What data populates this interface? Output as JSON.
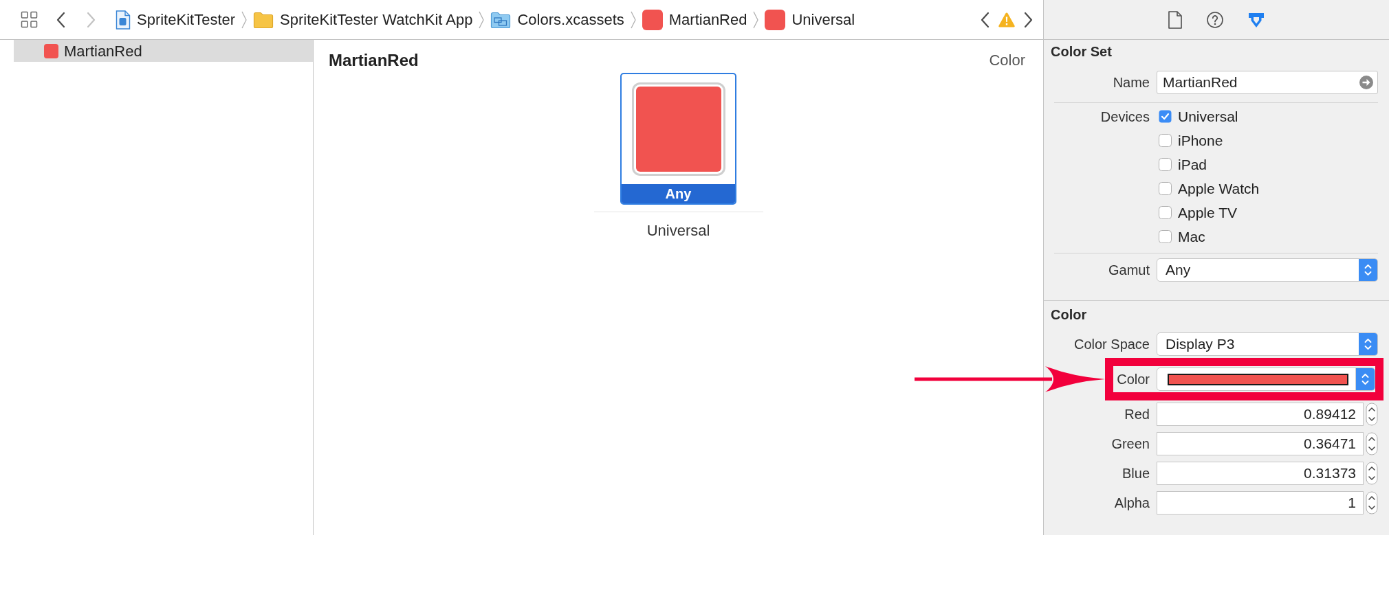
{
  "navigator_bar": {
    "back": {
      "disabled": false
    },
    "forward": {
      "disabled": true
    },
    "breadcrumbs": [
      {
        "kind": "project",
        "label": "SpriteKitTester"
      },
      {
        "kind": "folder",
        "label": "SpriteKitTester WatchKit App"
      },
      {
        "kind": "asset-catalog",
        "label": "Colors.xcassets"
      },
      {
        "kind": "color",
        "label": "MartianRed",
        "color": "#f15350"
      },
      {
        "kind": "color",
        "label": "Universal",
        "color": "#f15350"
      }
    ]
  },
  "inspector_tabs": [
    {
      "kind": "file",
      "selected": false
    },
    {
      "kind": "help",
      "selected": false
    },
    {
      "kind": "attributes",
      "selected": true
    }
  ],
  "sidebar": {
    "items": [
      {
        "label": "MartianRed",
        "color": "#f15350",
        "selected": true
      }
    ]
  },
  "editor": {
    "title": "MartianRed",
    "type_label": "Color",
    "slots": [
      {
        "label": "Any",
        "caption": "Universal",
        "color": "#f15350",
        "selected": true
      }
    ]
  },
  "inspector": {
    "color_set": {
      "title": "Color Set",
      "name": {
        "label": "Name",
        "value": "MartianRed"
      },
      "devices": {
        "label": "Devices",
        "options": [
          {
            "label": "Universal",
            "checked": true
          },
          {
            "label": "iPhone",
            "checked": false
          },
          {
            "label": "iPad",
            "checked": false
          },
          {
            "label": "Apple Watch",
            "checked": false
          },
          {
            "label": "Apple TV",
            "checked": false
          },
          {
            "label": "Mac",
            "checked": false
          }
        ]
      },
      "gamut": {
        "label": "Gamut",
        "value": "Any"
      }
    },
    "color": {
      "title": "Color",
      "rows": [
        {
          "kind": "popup",
          "label": "Color Space",
          "value": "Display P3",
          "highlighted": false
        },
        {
          "kind": "well",
          "label": "Color",
          "color": "#f15350",
          "highlighted": true
        },
        {
          "kind": "number",
          "label": "Red",
          "value": "0.89412",
          "highlighted": false
        },
        {
          "kind": "number",
          "label": "Green",
          "value": "0.36471",
          "highlighted": false
        },
        {
          "kind": "number",
          "label": "Blue",
          "value": "0.31373",
          "highlighted": false
        },
        {
          "kind": "number",
          "label": "Alpha",
          "value": "1",
          "highlighted": false
        }
      ]
    }
  }
}
